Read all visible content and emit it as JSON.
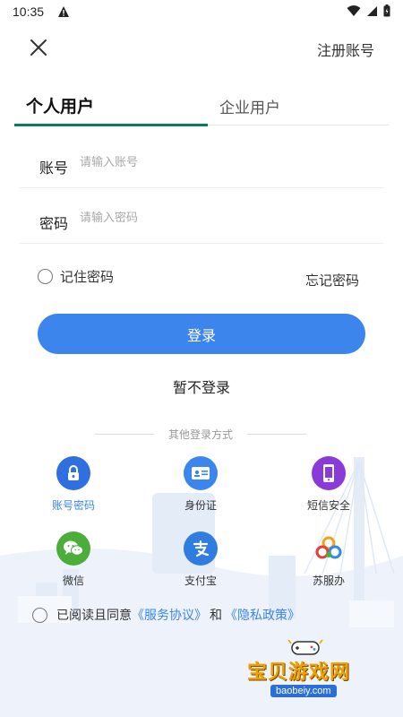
{
  "status_bar": {
    "time": "10:35"
  },
  "header": {
    "register_label": "注册账号"
  },
  "tabs": [
    {
      "label": "个人用户"
    },
    {
      "label": "企业用户"
    }
  ],
  "form": {
    "account": {
      "label": "账号",
      "placeholder": "请输入账号",
      "value": ""
    },
    "password": {
      "label": "密码",
      "placeholder": "请输入密码",
      "value": ""
    },
    "remember_label": "记住密码",
    "forgot_label": "忘记密码",
    "login_label": "登录",
    "skip_label": "暂不登录"
  },
  "other_methods": {
    "title": "其他登录方式",
    "items": [
      {
        "label": "账号密码",
        "icon": "lock-icon",
        "color": "#2f6fe0",
        "label_color": "#3b85ec"
      },
      {
        "label": "身份证",
        "icon": "id-card-icon",
        "color": "#3b85ec",
        "label_color": "#333333"
      },
      {
        "label": "短信安全",
        "icon": "phone-icon",
        "color": "#8a3ad6",
        "label_color": "#333333"
      },
      {
        "label": "微信",
        "icon": "wechat-icon",
        "color": "#4cae3a",
        "label_color": "#333333"
      },
      {
        "label": "支付宝",
        "icon": "alipay-icon",
        "color": "#2f7de0",
        "label_color": "#333333"
      },
      {
        "label": "苏服办",
        "icon": "sufuban-icon",
        "color": "#ffffff",
        "label_color": "#333333"
      }
    ]
  },
  "agreement": {
    "prefix": "已阅读且同意",
    "service_link": "《服务协议》",
    "conjunction": "和",
    "privacy_link": "《隐私政策》"
  },
  "watermark": {
    "title": "宝贝游戏网",
    "url": "baobeiy.com"
  },
  "colors": {
    "primary": "#3b85ec",
    "tab_accent": "#0a7a66"
  }
}
